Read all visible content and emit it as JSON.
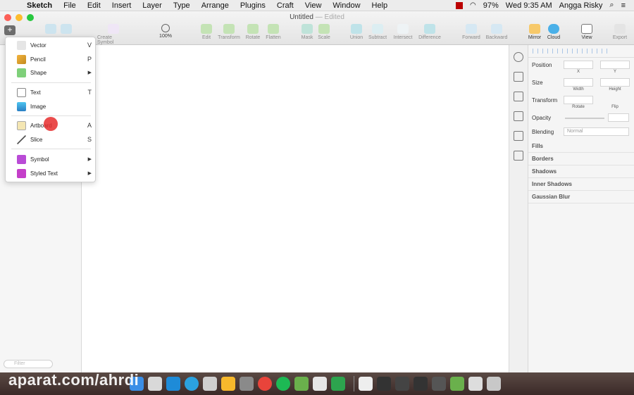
{
  "menubar": {
    "app": "Sketch",
    "items": [
      "File",
      "Edit",
      "Insert",
      "Layer",
      "Type",
      "Arrange",
      "Plugins",
      "Craft",
      "View",
      "Window",
      "Help"
    ],
    "battery": "97%",
    "clock": "Wed 9:35 AM",
    "user": "Angga Risky"
  },
  "window": {
    "title": "Untitled",
    "status": "— Edited"
  },
  "toolbar": {
    "create_symbol": "Create Symbol",
    "zoom": "100%",
    "edit": "Edit",
    "transform": "Transform",
    "rotate": "Rotate",
    "flatten": "Flatten",
    "mask": "Mask",
    "scale": "Scale",
    "union": "Union",
    "subtract": "Subtract",
    "intersect": "Intersect",
    "difference": "Difference",
    "forward": "Forward",
    "backward": "Backward",
    "mirror": "Mirror",
    "cloud": "Cloud",
    "view": "View",
    "export": "Export"
  },
  "insert_menu": {
    "items": [
      {
        "label": "Vector",
        "shortcut": "V",
        "icon": "vector-icon"
      },
      {
        "label": "Pencil",
        "shortcut": "P",
        "icon": "pencil-icon"
      },
      {
        "label": "Shape",
        "shortcut": "▶",
        "icon": "shape-icon"
      },
      {
        "label": "Text",
        "shortcut": "T",
        "icon": "text-icon"
      },
      {
        "label": "Image",
        "shortcut": "",
        "icon": "image-icon"
      },
      {
        "label": "Artboard",
        "shortcut": "A",
        "icon": "artboard-icon"
      },
      {
        "label": "Slice",
        "shortcut": "S",
        "icon": "slice-icon"
      },
      {
        "label": "Symbol",
        "shortcut": "▶",
        "icon": "symbol-icon"
      },
      {
        "label": "Styled Text",
        "shortcut": "▶",
        "icon": "styled-text-icon"
      }
    ]
  },
  "sidebar": {
    "filter_placeholder": "Filter"
  },
  "inspector": {
    "position_label": "Position",
    "x_label": "X",
    "y_label": "Y",
    "size_label": "Size",
    "width_label": "Width",
    "height_label": "Height",
    "transform_label": "Transform",
    "rotate_label": "Rotate",
    "flip_label": "Flip",
    "opacity_label": "Opacity",
    "blending_label": "Blending",
    "blending_value": "Normal",
    "sections": [
      "Fills",
      "Borders",
      "Shadows",
      "Inner Shadows",
      "Gaussian Blur"
    ]
  },
  "watermark": "aparat.com/ahrdi",
  "colors": {
    "accent": "#3a88fe",
    "cursor": "#e62d2d"
  }
}
